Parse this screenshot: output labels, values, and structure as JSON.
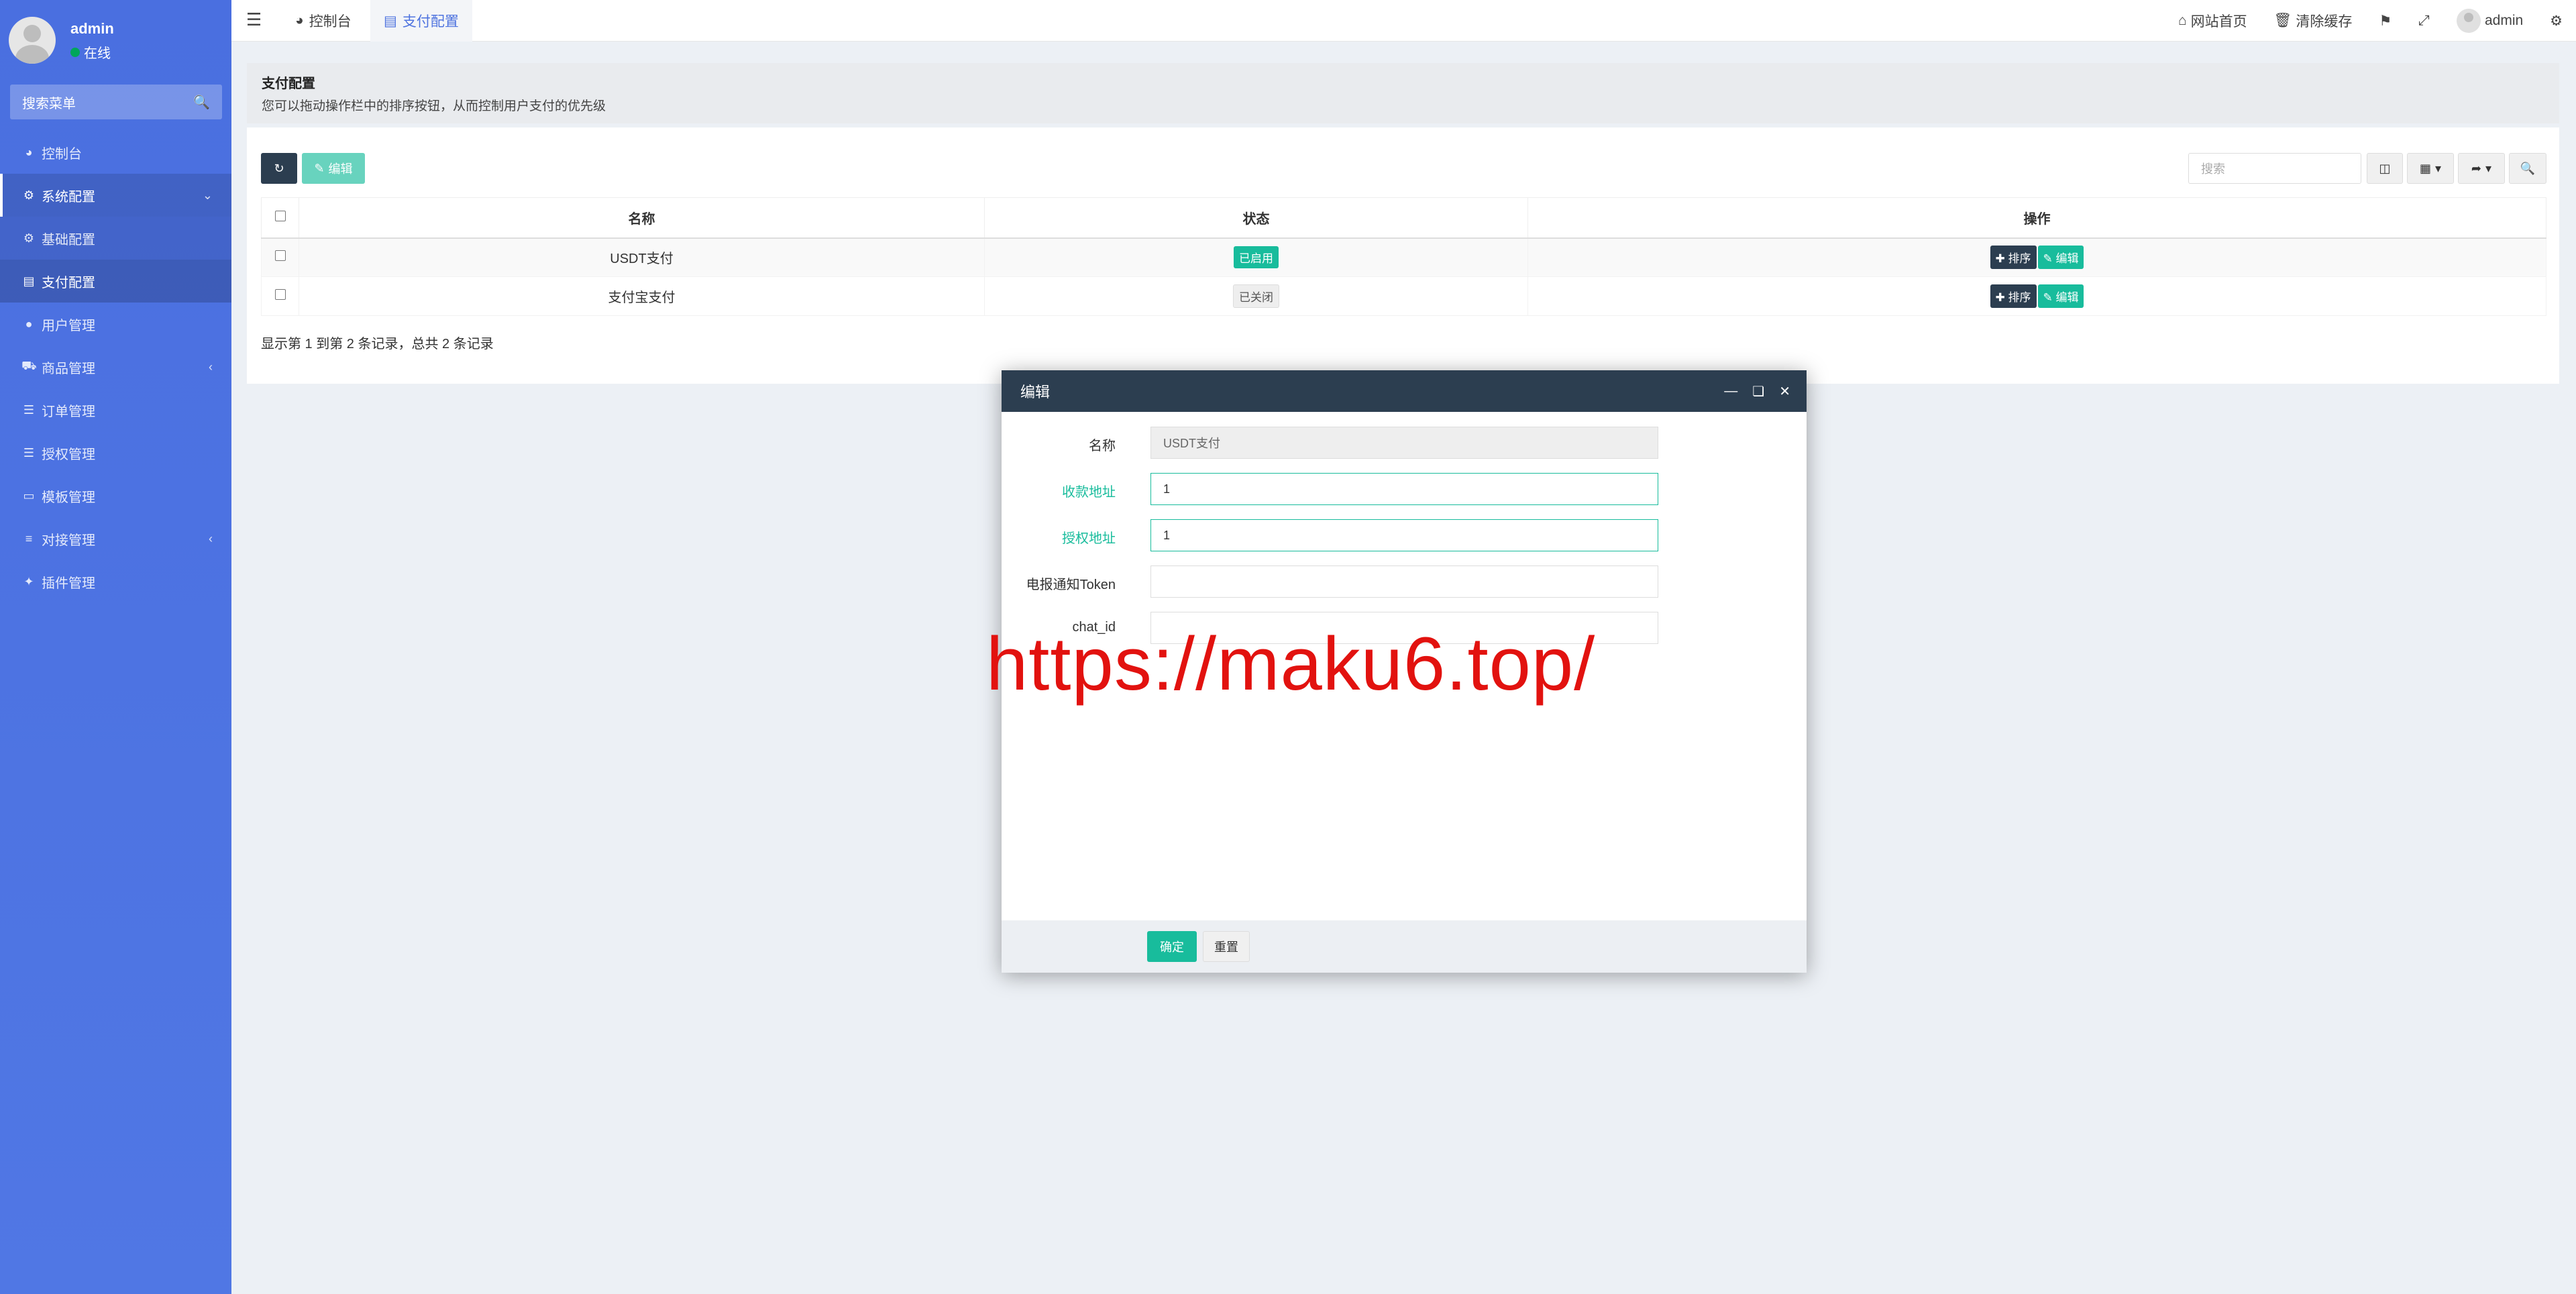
{
  "sidebar": {
    "user": {
      "name": "admin",
      "status": "在线"
    },
    "search_placeholder": "搜索菜单",
    "items": [
      {
        "label": "控制台",
        "icon": "dashboard-icon"
      },
      {
        "label": "系统配置",
        "icon": "gear-icon"
      },
      {
        "label": "基础配置",
        "icon": "gear-icon"
      },
      {
        "label": "支付配置",
        "icon": "table-icon"
      },
      {
        "label": "用户管理",
        "icon": "user-icon"
      },
      {
        "label": "商品管理",
        "icon": "cart-icon"
      },
      {
        "label": "订单管理",
        "icon": "list-icon"
      },
      {
        "label": "授权管理",
        "icon": "list-icon"
      },
      {
        "label": "模板管理",
        "icon": "template-icon"
      },
      {
        "label": "对接管理",
        "icon": "sliders-icon"
      },
      {
        "label": "插件管理",
        "icon": "plugin-icon"
      }
    ]
  },
  "navbar": {
    "tabs": [
      {
        "label": "控制台"
      },
      {
        "label": "支付配置"
      }
    ],
    "right": {
      "home": "网站首页",
      "clear_cache": "清除缓存",
      "user": "admin"
    }
  },
  "header": {
    "title": "支付配置",
    "description": "您可以拖动操作栏中的排序按钮，从而控制用户支付的优先级"
  },
  "toolbar": {
    "edit_label": "编辑",
    "search_placeholder": "搜索"
  },
  "table": {
    "columns": [
      "名称",
      "状态",
      "操作"
    ],
    "rows": [
      {
        "name": "USDT支付",
        "status": "已启用"
      },
      {
        "name": "支付宝支付",
        "status": "已关闭"
      }
    ],
    "sort_label": "排序",
    "edit_label": "编辑",
    "pager": "显示第 1 到第 2 条记录，总共 2 条记录"
  },
  "modal": {
    "title": "编辑",
    "fields": [
      {
        "label": "名称",
        "value": "USDT支付"
      },
      {
        "label": "收款地址",
        "value": "1"
      },
      {
        "label": "授权地址",
        "value": "1"
      },
      {
        "label": "电报通知Token",
        "value": ""
      },
      {
        "label": "chat_id",
        "value": ""
      }
    ],
    "confirm": "确定",
    "reset": "重置"
  },
  "watermark": "https://maku6.top/",
  "colors": {
    "sidebar": "#4e73df",
    "accent": "#18bc9c",
    "dark": "#2c3e50",
    "watermark": "#e2120f"
  }
}
